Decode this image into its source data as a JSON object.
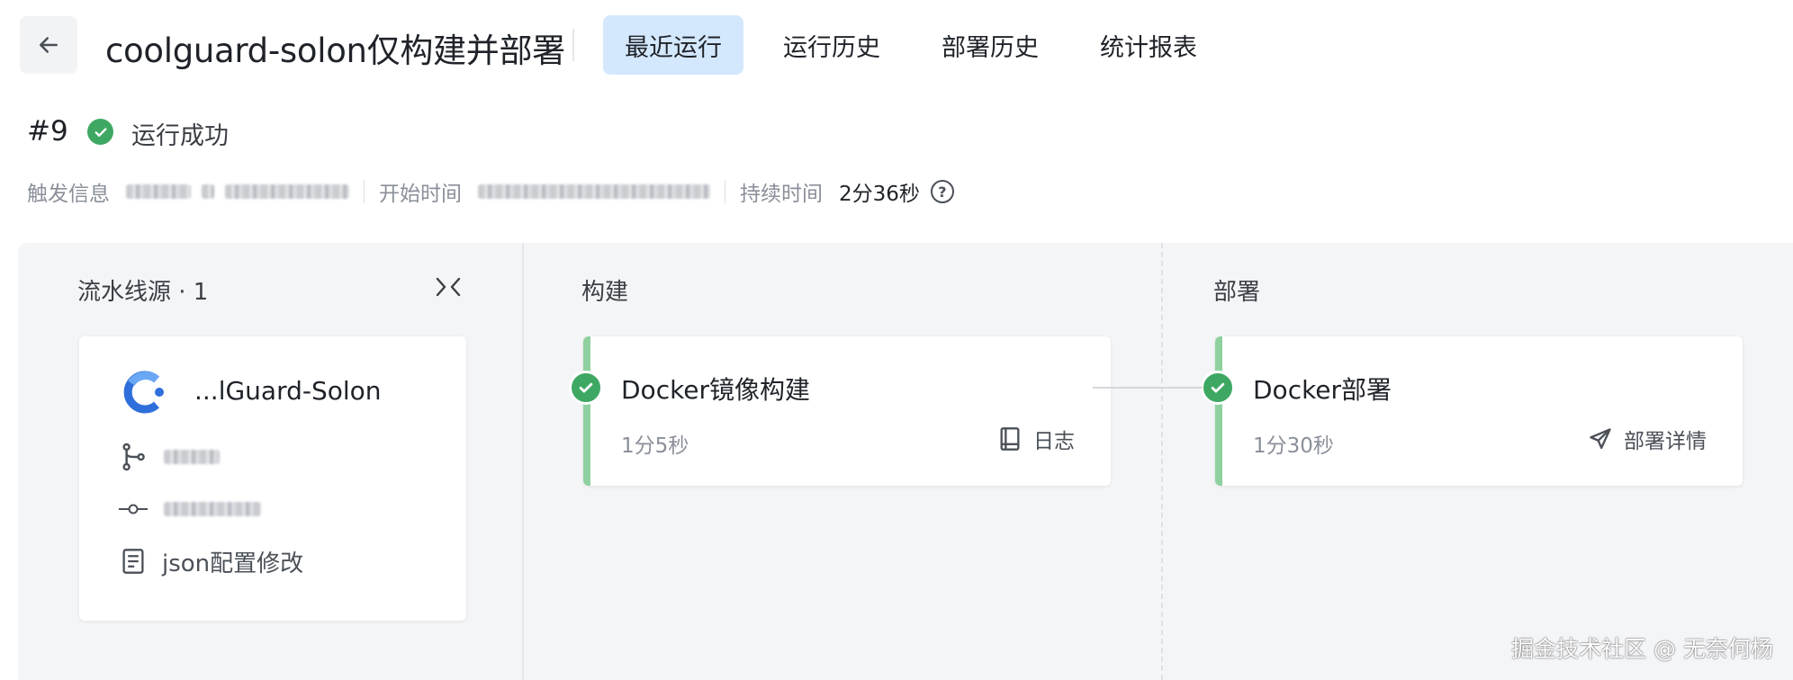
{
  "header": {
    "back_icon": "arrow-left-icon",
    "title": "coolguard-solon仅构建并部署",
    "tabs": [
      {
        "label": "最近运行",
        "active": true
      },
      {
        "label": "运行历史",
        "active": false
      },
      {
        "label": "部署历史",
        "active": false
      },
      {
        "label": "统计报表",
        "active": false
      }
    ]
  },
  "run": {
    "number": "#9",
    "status": "运行成功",
    "status_color": "#3ea863"
  },
  "meta": {
    "trigger_label": "触发信息",
    "start_label": "开始时间",
    "duration_label": "持续时间",
    "duration_value": "2分36秒"
  },
  "pipeline": {
    "source_column": {
      "header": "流水线源 · 1",
      "collapse_icon": "collapse-arrows-icon",
      "card": {
        "name": "...lGuard-Solon",
        "commit_message": "json配置修改"
      }
    },
    "build_column": {
      "header": "构建",
      "job": {
        "title": "Docker镜像构建",
        "duration": "1分5秒",
        "action_label": "日志",
        "action_icon": "book-icon"
      }
    },
    "deploy_column": {
      "header": "部署",
      "job": {
        "title": "Docker部署",
        "duration": "1分30秒",
        "action_label": "部署详情",
        "action_icon": "send-icon"
      }
    },
    "accent_color": "#8fd19e"
  },
  "watermark": "掘金技术社区 @ 无奈何杨"
}
